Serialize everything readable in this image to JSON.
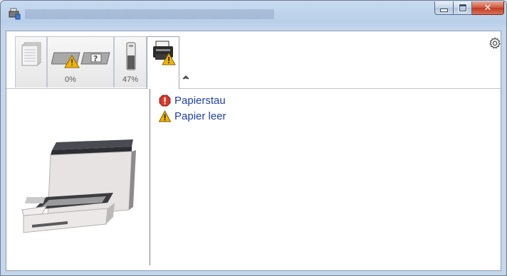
{
  "window": {
    "title": "",
    "controls": {
      "minimize": "minimize",
      "maximize": "maximize",
      "close": "close"
    }
  },
  "tabs": [
    {
      "icon": "documents-stack-icon",
      "label": ""
    },
    {
      "icon": "toner-cartridges-icon",
      "label": "0%"
    },
    {
      "icon": "toner-bottle-icon",
      "label": "47%"
    },
    {
      "icon": "printer-warning-icon",
      "label": ""
    }
  ],
  "toolbar": {
    "settings_icon": "gear-icon",
    "collapse_icon": "chevron-up-icon"
  },
  "status": {
    "items": [
      {
        "label": "Papierstau",
        "icon": "error-icon",
        "color": "#d9372b"
      },
      {
        "label": "Papier leer",
        "icon": "warning-icon",
        "color": "#f2b400"
      }
    ]
  },
  "colors": {
    "link": "#1f3fa8",
    "frame": "#c4d6ec",
    "close_button": "#c13a20"
  }
}
